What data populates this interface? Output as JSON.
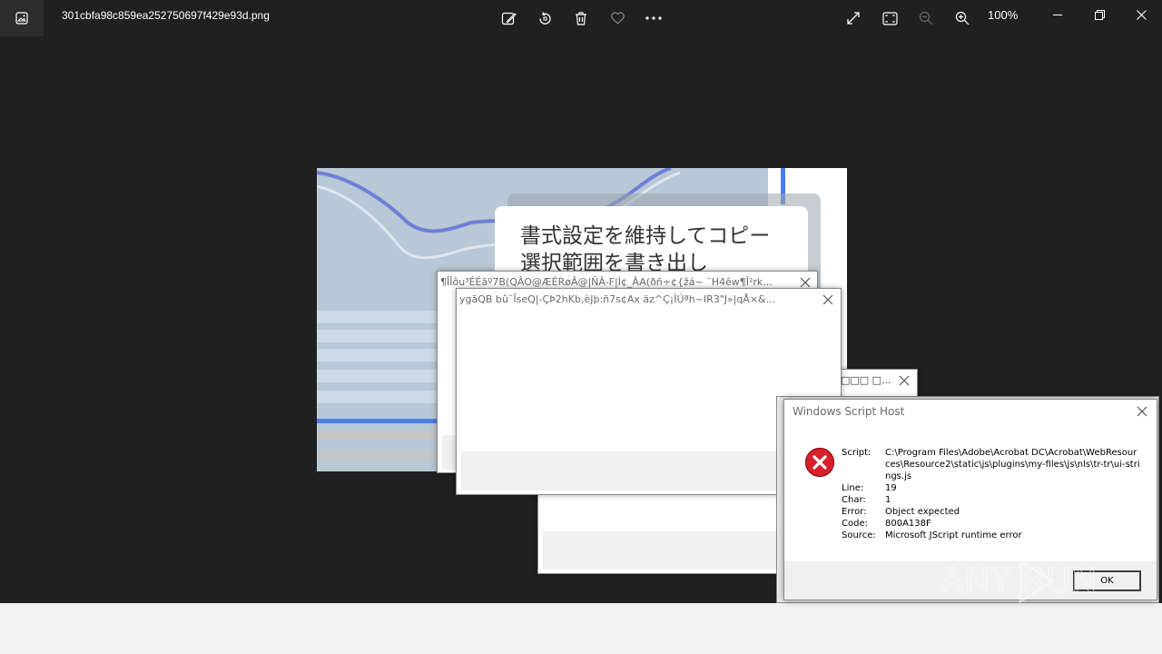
{
  "viewer": {
    "filename": "301cbfa98c859ea252750697f429e93d.png",
    "zoom": "100%",
    "toolbar_icons": [
      "edit-image-icon",
      "rotate-icon",
      "delete-icon",
      "favorite-icon",
      "more-icon"
    ],
    "right_icons": [
      "fullscreen-icon",
      "fit-window-icon",
      "zoom-out-icon",
      "zoom-in-icon"
    ],
    "window_controls": [
      "minimize-icon",
      "restore-icon",
      "close-icon"
    ]
  },
  "image": {
    "card_line1": "書式設定を維持してコピー",
    "card_line2": "選択範囲を書き出し"
  },
  "windows": {
    "garbled1_title": "¶ÎÎôu³ÉÉãº7B(QÂO@ÆÉRøÂ@|ÑÂ-F|Ì¢_ÂA(ðñ÷¢{žá~ ¨H4êw¶Î²rk...",
    "garbled2_title": "ygãQB  bû¨ÎseQ|-ÇÞ2hKb,èJþ:ñ7s¢Ax äz^Ç¡ÌÚªh~IR3\"J»|qÅ×&...",
    "small_title": "□□□  □..."
  },
  "dialog": {
    "title": "Windows Script Host",
    "script_label": "Script:",
    "script_value": "C:\\Program Files\\Adobe\\Acrobat DC\\Acrobat\\WebResources\\Resource2\\static\\js\\plugins\\my-files\\js\\nls\\tr-tr\\ui-strings.js",
    "line_label": "Line:",
    "line_value": "19",
    "char_label": "Char:",
    "char_value": "1",
    "error_label": "Error:",
    "error_value": "Object expected",
    "code_label": "Code:",
    "code_value": "800A138F",
    "source_label": "Source:",
    "source_value": "Microsoft JScript runtime error",
    "ok_label": "OK"
  },
  "watermark": "ANY RUN"
}
